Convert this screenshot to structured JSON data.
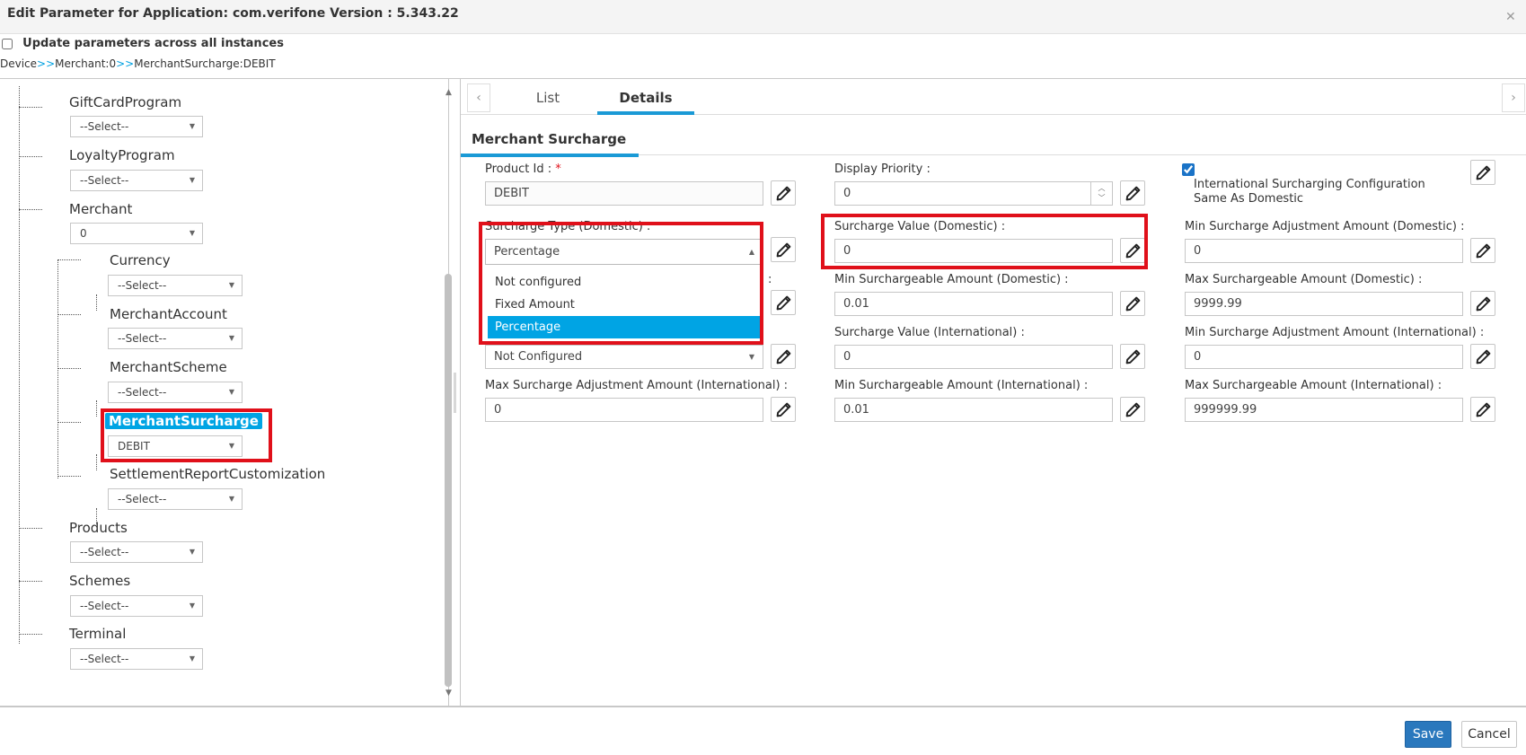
{
  "dialog": {
    "title": "Edit Parameter for Application: com.verifone Version : 5.343.22",
    "update_label": "Update parameters across all instances",
    "breadcrumb": [
      {
        "label": "Device"
      },
      {
        "sep": ">>"
      },
      {
        "label": "Merchant:0"
      },
      {
        "sep": ">>"
      },
      {
        "label": "MerchantSurcharge:DEBIT"
      }
    ]
  },
  "tree": {
    "nodes": [
      {
        "label": "GiftCardProgram",
        "value": "--Select--"
      },
      {
        "label": "LoyaltyProgram",
        "value": "--Select--"
      },
      {
        "label": "Merchant",
        "value": "0"
      },
      {
        "label": "Currency",
        "value": "--Select--"
      },
      {
        "label": "MerchantAccount",
        "value": "--Select--"
      },
      {
        "label": "MerchantScheme",
        "value": "--Select--"
      },
      {
        "label": "MerchantSurcharge",
        "value": "DEBIT"
      },
      {
        "label": "SettlementReportCustomization",
        "value": "--Select--"
      },
      {
        "label": "Products",
        "value": "--Select--"
      },
      {
        "label": "Schemes",
        "value": "--Select--"
      },
      {
        "label": "Terminal",
        "value": "--Select--"
      }
    ]
  },
  "tabs": [
    {
      "label": "List"
    },
    {
      "label": "Details"
    }
  ],
  "section_title": "Merchant Surcharge",
  "fields": {
    "product_id": {
      "label": "Product Id :",
      "required": "*",
      "value": "DEBIT"
    },
    "display_priority": {
      "label": "Display Priority :",
      "value": "0"
    },
    "intl_same_as_domestic": {
      "label_line1": "International Surcharging Configuration",
      "label_line2": "Same As Domestic",
      "checked": true
    },
    "surcharge_type_domestic": {
      "label": "Surcharge Type (Domestic) :",
      "value": "Percentage"
    },
    "surcharge_value_domestic": {
      "label": "Surcharge Value (Domestic) :",
      "value": "0"
    },
    "min_adj_domestic": {
      "label": "Min Surcharge Adjustment Amount (Domestic) :",
      "value": "0"
    },
    "hidden_row_colon": ":",
    "min_surchargeable_domestic": {
      "label": "Min Surchargeable Amount (Domestic) :",
      "value": "0.01"
    },
    "max_surchargeable_domestic": {
      "label": "Max Surchargeable Amount (Domestic) :",
      "value": "9999.99"
    },
    "surcharge_type_intl": {
      "value": "Not Configured"
    },
    "surcharge_value_intl": {
      "label": "Surcharge Value (International) :",
      "value": "0"
    },
    "min_adj_intl": {
      "label": "Min Surcharge Adjustment Amount (International) :",
      "value": "0"
    },
    "max_adj_intl": {
      "label": "Max Surcharge Adjustment Amount (International) :",
      "value": "0"
    },
    "min_surchargeable_intl": {
      "label": "Min Surchargeable Amount (International) :",
      "value": "0.01"
    },
    "max_surchargeable_intl": {
      "label": "Max Surchargeable Amount (International) :",
      "value": "999999.99"
    }
  },
  "dropdown_options": [
    "Not configured",
    "Fixed Amount",
    "Percentage"
  ],
  "buttons": {
    "save": "Save",
    "cancel": "Cancel"
  },
  "colors": {
    "accent": "#00a4e4",
    "highlight": "#e0101a",
    "primary_button": "#2a78bd"
  }
}
